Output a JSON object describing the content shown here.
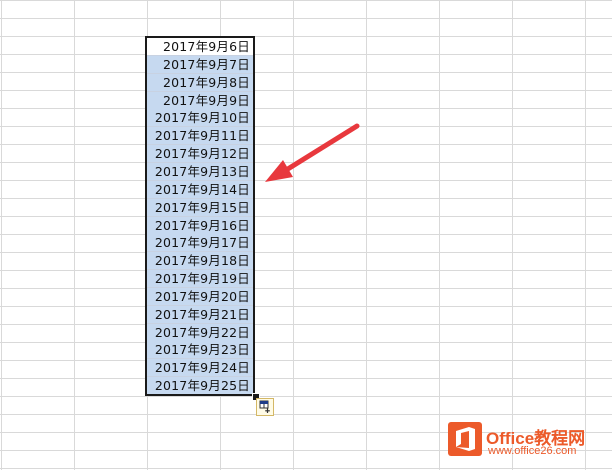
{
  "sheet": {
    "dates": [
      "2017年9月6日",
      "2017年9月7日",
      "2017年9月8日",
      "2017年9月9日",
      "2017年9月10日",
      "2017年9月11日",
      "2017年9月12日",
      "2017年9月13日",
      "2017年9月14日",
      "2017年9月15日",
      "2017年9月16日",
      "2017年9月17日",
      "2017年9月18日",
      "2017年9月19日",
      "2017年9月20日",
      "2017年9月21日",
      "2017年9月22日",
      "2017年9月23日",
      "2017年9月24日",
      "2017年9月25日"
    ],
    "selection_fill_color": "#c6d9f0",
    "grid_line_color": "#d9d9d9"
  },
  "annotation": {
    "arrow_color": "#e8383d"
  },
  "watermark": {
    "brand": "Office教程网",
    "url": "www.office26.com",
    "brand_color": "#ec5a2a",
    "icon": "office-logo-icon"
  },
  "icons": {
    "autofill": "autofill-options-icon"
  }
}
